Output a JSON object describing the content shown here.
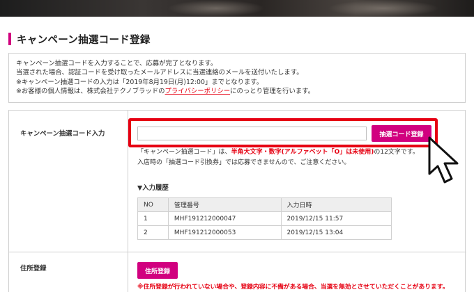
{
  "page": {
    "title": "キャンペーン抽選コード登録"
  },
  "info": {
    "line1": "キャンペーン抽選コードを入力することで、応募が完了となります。",
    "line2": "当選された場合、認証コードを受け取ったメールアドレスに当選連絡のメールを送付いたします。",
    "line3": "※キャンペーン抽選コードの入力は「2019年8月19日(月)12:00」までとなります。",
    "line4_pre": "※お客様の個人情報は、株式会社テクノブラッドの",
    "line4_link": "プライバシーポリシー",
    "line4_post": "にのっとり管理を行います。"
  },
  "form": {
    "code_label": "キャンペーン抽選コード入力",
    "code_value": "",
    "register_button": "抽選コード登録",
    "note_pre": "「キャンペーン抽選コード」は、",
    "note_red": "半角大文字・数字(アルファベット「O」は未使用)",
    "note_post": "の12文字です。",
    "note2": "入店時の「抽選コード引換券」では応募できませんので、ご注意ください。",
    "history_title": "▼入力履歴",
    "history": {
      "headers": [
        "NO",
        "管理番号",
        "入力日時"
      ],
      "rows": [
        [
          "1",
          "MHF191212000047",
          "2019/12/15 11:57"
        ],
        [
          "2",
          "MHF191212000053",
          "2019/12/15 13:04"
        ]
      ]
    },
    "address_label": "住所登録",
    "address_button": "住所登録",
    "address_note": "※住所登録が行われていない場合や、登録内容に不備がある場合、当選を無効とさせていただくことがあります。"
  },
  "colors": {
    "accent": "#d1007f",
    "highlight": "#e60012",
    "link": "#e60012"
  },
  "icons": {
    "cursor": "mouse-pointer-icon"
  }
}
